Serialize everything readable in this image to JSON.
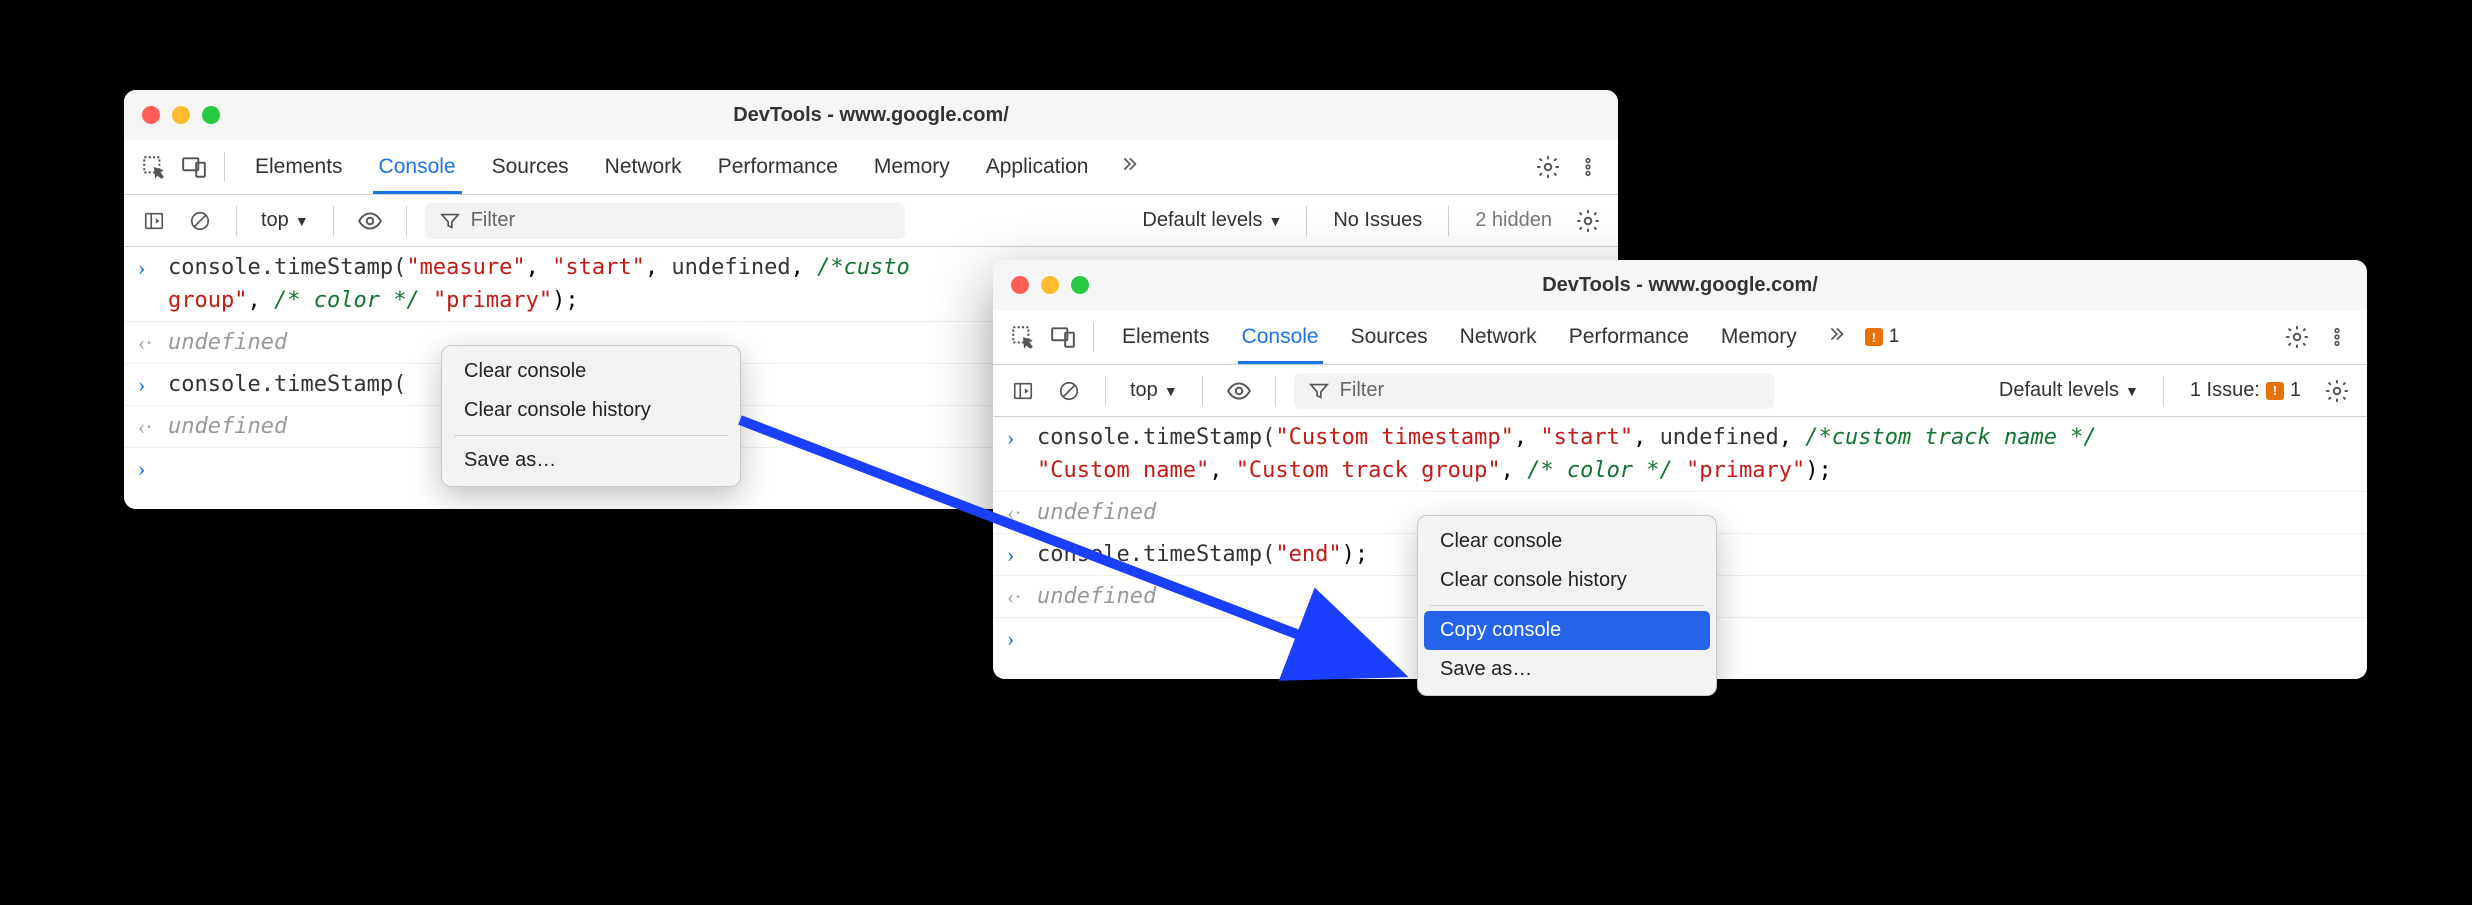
{
  "window1": {
    "title": "DevTools - www.google.com/",
    "tabs": [
      "Elements",
      "Console",
      "Sources",
      "Network",
      "Performance",
      "Memory",
      "Application"
    ],
    "activeTab": "Console",
    "subbar": {
      "context": "top",
      "filterPlaceholder": "Filter",
      "levels": "Default levels",
      "issues": "No Issues",
      "hidden": "2 hidden"
    },
    "console": {
      "line1": {
        "obj": "console",
        "method": ".timeStamp(",
        "a1": "\"measure\"",
        "a2": "\"start\"",
        "a3": "undefined",
        "c1": "/*custo",
        "cont1": "group\"",
        "c2": "/* color */",
        "a4": "\"primary\"",
        "end": ");"
      },
      "und": "undefined",
      "line2": {
        "obj": "console",
        "method": ".timeStamp("
      }
    },
    "menu": {
      "i1": "Clear console",
      "i2": "Clear console history",
      "i3": "Save as…"
    }
  },
  "window2": {
    "title": "DevTools - www.google.com/",
    "tabs": [
      "Elements",
      "Console",
      "Sources",
      "Network",
      "Performance",
      "Memory"
    ],
    "activeTab": "Console",
    "issueCount": "1",
    "subbar": {
      "context": "top",
      "filterPlaceholder": "Filter",
      "levels": "Default levels",
      "issues": "1 Issue:",
      "issuesCount": "1"
    },
    "console": {
      "line1a": {
        "obj": "console",
        "method": ".timeStamp(",
        "a1": "\"Custom timestamp\"",
        "a2": "\"start\"",
        "a3": "undefined",
        "c1": "/*custom track name */"
      },
      "line1b": {
        "a4": "\"Custom name\"",
        "a5": "\"Custom track group\"",
        "c2": "/* color */",
        "a6": "\"primary\"",
        "end": ");"
      },
      "und": "undefined",
      "line2": {
        "obj": "console",
        "method": ".timeStamp(",
        "a1": "\"end\"",
        "end": ");"
      }
    },
    "menu": {
      "i1": "Clear console",
      "i2": "Clear console history",
      "i3": "Copy console",
      "i4": "Save as…"
    }
  }
}
